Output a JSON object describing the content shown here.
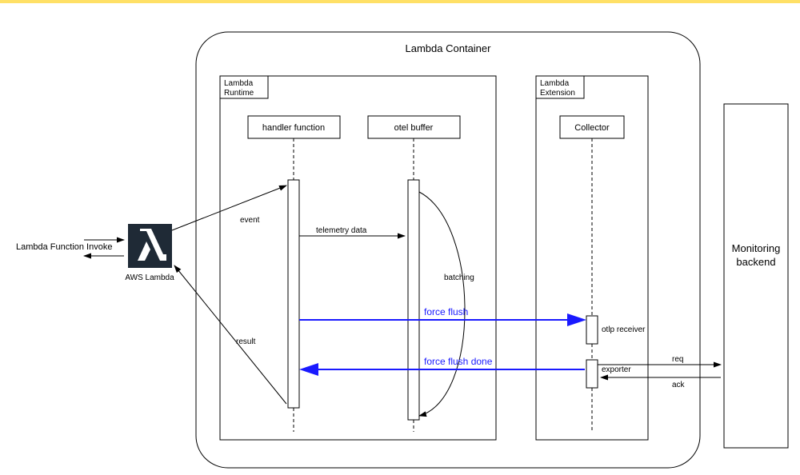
{
  "title": "Lambda Container",
  "labels": {
    "invoke": "Lambda Function Invoke",
    "aws_lambda": "AWS Lambda",
    "runtime": "Lambda\nRuntime",
    "extension": "Lambda\nExtension",
    "handler": "handler function",
    "otel_buffer": "otel buffer",
    "collector": "Collector",
    "monitoring": "Monitoring\nbackend",
    "event": "event",
    "telemetry": "telemetry data",
    "batching": "batching",
    "force_flush": "force flush",
    "force_flush_done": "force flush done",
    "otlp_receiver": "otlp receiver",
    "exporter": "exporter",
    "result": "result",
    "req": "req",
    "ack": "ack"
  }
}
